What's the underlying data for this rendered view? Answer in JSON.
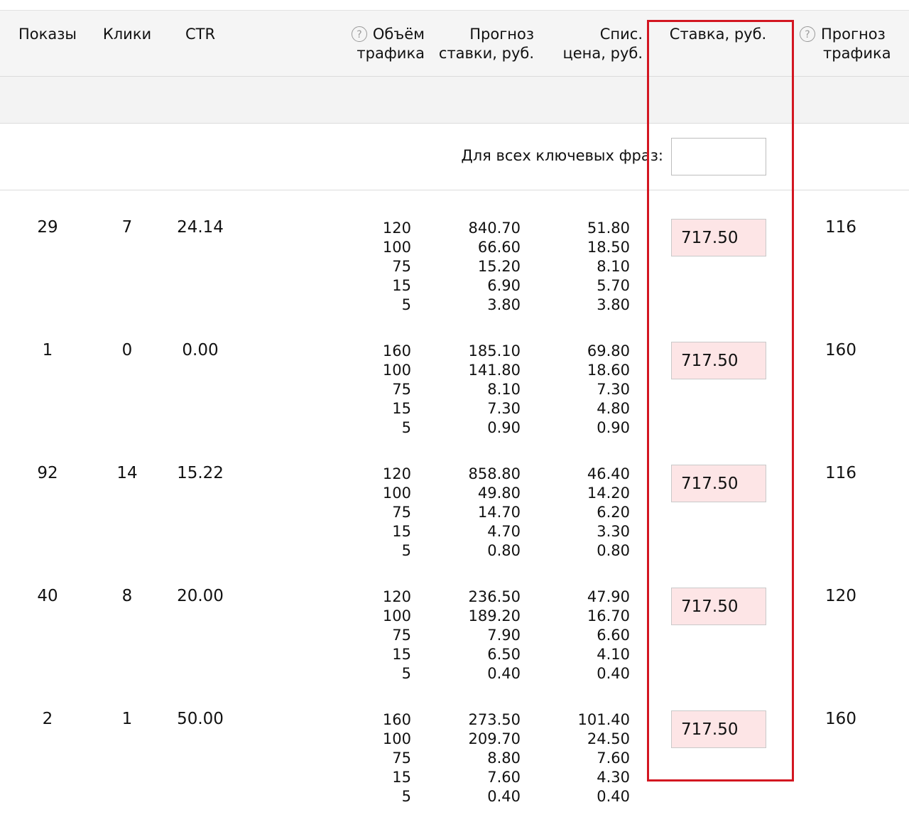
{
  "header": {
    "shows": "Показы",
    "clicks": "Клики",
    "ctr": "CTR",
    "volume_line1": "Объём",
    "volume_line2": "трафика",
    "forecast_bid_line1": "Прогноз",
    "forecast_bid_line2": "ставки, руб.",
    "charge_line1": "Спис.",
    "charge_line2": "цена, руб.",
    "bid": "Ставка, руб.",
    "traffic_forecast_line1": "Прогноз",
    "traffic_forecast_line2": "трафика",
    "help_icon_glyph": "?"
  },
  "all_keywords": {
    "label": "Для всех ключевых фраз:",
    "value": ""
  },
  "rows": [
    {
      "shows": "29",
      "clicks": "7",
      "ctr": "24.14",
      "volumes": [
        "120",
        "100",
        "75",
        "15",
        "5"
      ],
      "forecast_bids": [
        "840.70",
        "66.60",
        "15.20",
        "6.90",
        "3.80"
      ],
      "charge_prices": [
        "51.80",
        "18.50",
        "8.10",
        "5.70",
        "3.80"
      ],
      "bid": "717.50",
      "traffic_forecast": "116"
    },
    {
      "shows": "1",
      "clicks": "0",
      "ctr": "0.00",
      "volumes": [
        "160",
        "100",
        "75",
        "15",
        "5"
      ],
      "forecast_bids": [
        "185.10",
        "141.80",
        "8.10",
        "7.30",
        "0.90"
      ],
      "charge_prices": [
        "69.80",
        "18.60",
        "7.30",
        "4.80",
        "0.90"
      ],
      "bid": "717.50",
      "traffic_forecast": "160"
    },
    {
      "shows": "92",
      "clicks": "14",
      "ctr": "15.22",
      "volumes": [
        "120",
        "100",
        "75",
        "15",
        "5"
      ],
      "forecast_bids": [
        "858.80",
        "49.80",
        "14.70",
        "4.70",
        "0.80"
      ],
      "charge_prices": [
        "46.40",
        "14.20",
        "6.20",
        "3.30",
        "0.80"
      ],
      "bid": "717.50",
      "traffic_forecast": "116"
    },
    {
      "shows": "40",
      "clicks": "8",
      "ctr": "20.00",
      "volumes": [
        "120",
        "100",
        "75",
        "15",
        "5"
      ],
      "forecast_bids": [
        "236.50",
        "189.20",
        "7.90",
        "6.50",
        "0.40"
      ],
      "charge_prices": [
        "47.90",
        "16.70",
        "6.60",
        "4.10",
        "0.40"
      ],
      "bid": "717.50",
      "traffic_forecast": "120"
    },
    {
      "shows": "2",
      "clicks": "1",
      "ctr": "50.00",
      "volumes": [
        "160",
        "100",
        "75",
        "15",
        "5"
      ],
      "forecast_bids": [
        "273.50",
        "209.70",
        "8.80",
        "7.60",
        "0.40"
      ],
      "charge_prices": [
        "101.40",
        "24.50",
        "7.60",
        "4.30",
        "0.40"
      ],
      "bid": "717.50",
      "traffic_forecast": "160"
    }
  ],
  "colors": {
    "highlight_border": "#d31621",
    "bid_input_bg": "#fde5e6",
    "header_bg": "#f5f5f5"
  }
}
